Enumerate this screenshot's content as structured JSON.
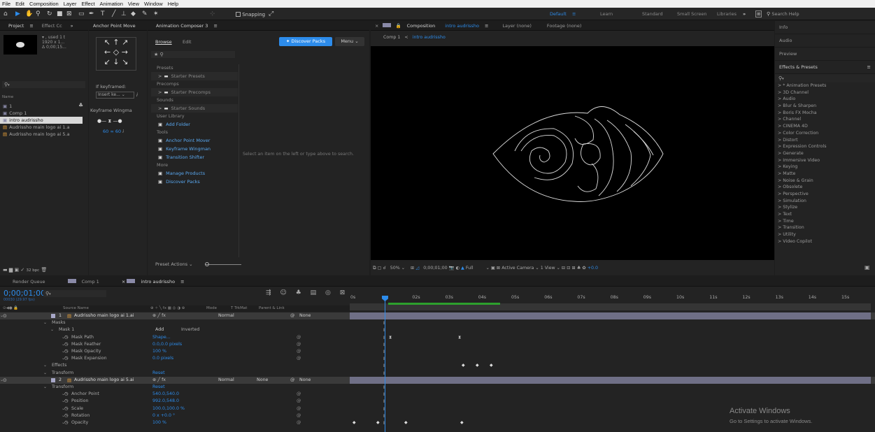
{
  "menu": [
    "File",
    "Edit",
    "Composition",
    "Layer",
    "Effect",
    "Animation",
    "View",
    "Window",
    "Help"
  ],
  "toolbar": {
    "snapping": "Snapping",
    "workspaces": [
      "Default",
      "Learn",
      "Standard",
      "Small Screen",
      "Libraries"
    ],
    "search_placeholder": "Search Help"
  },
  "project": {
    "tabs": [
      "Project",
      "Effect Cc"
    ],
    "thumb_info": [
      "▾ , used 1 t",
      "1920 x 1...",
      "Δ 0;00;15..."
    ],
    "name_header": "Name",
    "items": [
      {
        "name": "1",
        "type": "comp"
      },
      {
        "name": "Comp 1",
        "type": "comp"
      },
      {
        "name": "intro audrissho",
        "type": "comp",
        "selected": true
      },
      {
        "name": "Audrissho main logo ai 1.a",
        "type": "ai"
      },
      {
        "name": "Audrissho main logo ai 5.a",
        "type": "ai"
      }
    ],
    "bpc": "32 bpc"
  },
  "anchor": {
    "tab": "Anchor Point Move",
    "if_keyframed": "If keyframed:",
    "select_value": "Insert ke...",
    "wingman": "Keyframe Wingma",
    "val1": "60",
    "val2": "60"
  },
  "composer": {
    "tab": "Animation Composer 3",
    "browse": "Browse",
    "edit": "Edit",
    "discover": "✦ Discover Packs",
    "menu": "Menu",
    "sections": [
      {
        "title": "Presets",
        "items": [
          {
            "label": "Starter Presets",
            "kind": "folder"
          }
        ]
      },
      {
        "title": "Precomps",
        "items": [
          {
            "label": "Starter Precomps",
            "kind": "folder"
          }
        ]
      },
      {
        "title": "Sounds",
        "items": [
          {
            "label": "Starter Sounds",
            "kind": "folder"
          }
        ]
      },
      {
        "title": "User Library",
        "items": [
          {
            "label": "Add Folder",
            "kind": "link"
          }
        ]
      },
      {
        "title": "Tools",
        "items": [
          {
            "label": "Anchor Point Mover",
            "kind": "link"
          },
          {
            "label": "Keyframe Wingman",
            "kind": "link"
          },
          {
            "label": "Transition Shifter",
            "kind": "link"
          }
        ]
      },
      {
        "title": "More",
        "items": [
          {
            "label": "Manage Products",
            "kind": "link"
          },
          {
            "label": "Discover Packs",
            "kind": "link"
          }
        ]
      }
    ],
    "empty_hint": "Select an item on the left or type above to search.",
    "preset_actions": "Preset Actions"
  },
  "viewer": {
    "comp_tab_prefix": "Composition",
    "comp_name": "intro audrissho",
    "layer_tab": "Layer (none)",
    "footage_tab": "Footage (none)",
    "crumb1": "Comp 1",
    "crumb2": "intro audrissho",
    "zoom": "50%",
    "timecode": "0;00;01;00",
    "resolution": "Full",
    "camera": "Active Camera",
    "view": "1 View",
    "exposure": "+0.0"
  },
  "right": {
    "items": [
      "Info",
      "Audio",
      "Preview"
    ],
    "fx_title": "Effects & Presets",
    "fx_list": [
      "> * Animation Presets",
      "> 3D Channel",
      "> Audio",
      "> Blur & Sharpen",
      "> Boris FX Mocha",
      "> Channel",
      "> CINEMA 4D",
      "> Color Correction",
      "> Distort",
      "> Expression Controls",
      "> Generate",
      "> Immersive Video",
      "> Keying",
      "> Matte",
      "> Noise & Grain",
      "> Obsolete",
      "> Perspective",
      "> Simulation",
      "> Stylize",
      "> Text",
      "> Time",
      "> Transition",
      "> Utility",
      "> Video Copilot"
    ]
  },
  "timeline": {
    "tabs": [
      "Render Queue",
      "Comp 1",
      "intro audrissho"
    ],
    "timecode": "0;00;01;00",
    "fps": "00030 (29.97 fps)",
    "col_source": "Source Name",
    "col_mode": "Mode",
    "col_trkmat": "T  TrkMat",
    "col_parent": "Parent & Link",
    "ruler": [
      "0s",
      "",
      "02s",
      "03s",
      "04s",
      "05s",
      "06s",
      "07s",
      "08s",
      "09s",
      "10s",
      "11s",
      "12s",
      "13s",
      "14s",
      "15s"
    ],
    "rows": [
      {
        "indent": 0,
        "num": "1",
        "label": "Audrissho main logo ai 1.ai",
        "mode": "Normal",
        "parent": "None",
        "layer": true
      },
      {
        "indent": 1,
        "label": "Masks"
      },
      {
        "indent": 2,
        "label": "Mask 1",
        "add": "Add",
        "inverted": "Inverted"
      },
      {
        "indent": 3,
        "label": "Mask Path",
        "value": "Shape..."
      },
      {
        "indent": 3,
        "label": "Mask Feather",
        "value": "0.0,0.0 pixels"
      },
      {
        "indent": 3,
        "label": "Mask Opacity",
        "value": "100 %"
      },
      {
        "indent": 3,
        "label": "Mask Expansion",
        "value": "0.0 pixels"
      },
      {
        "indent": 1,
        "label": "Effects"
      },
      {
        "indent": 1,
        "label": "Transform",
        "value": "Reset"
      },
      {
        "indent": 0,
        "num": "2",
        "label": "Audrissho main logo ai 5.ai",
        "mode": "Normal",
        "trkmat": "None",
        "parent": "None",
        "layer": true
      },
      {
        "indent": 1,
        "label": "Transform",
        "value": "Reset"
      },
      {
        "indent": 3,
        "label": "Anchor Point",
        "value": "540.0,540.0"
      },
      {
        "indent": 3,
        "label": "Position",
        "value": "992.0,548.0"
      },
      {
        "indent": 3,
        "label": "Scale",
        "value": "100.0,100.0 %"
      },
      {
        "indent": 3,
        "label": "Rotation",
        "value": "0 x +0.0 °"
      },
      {
        "indent": 3,
        "label": "Opacity",
        "value": "100 %"
      }
    ]
  },
  "watermark": {
    "title": "Activate Windows",
    "subtitle": "Go to Settings to activate Windows."
  }
}
